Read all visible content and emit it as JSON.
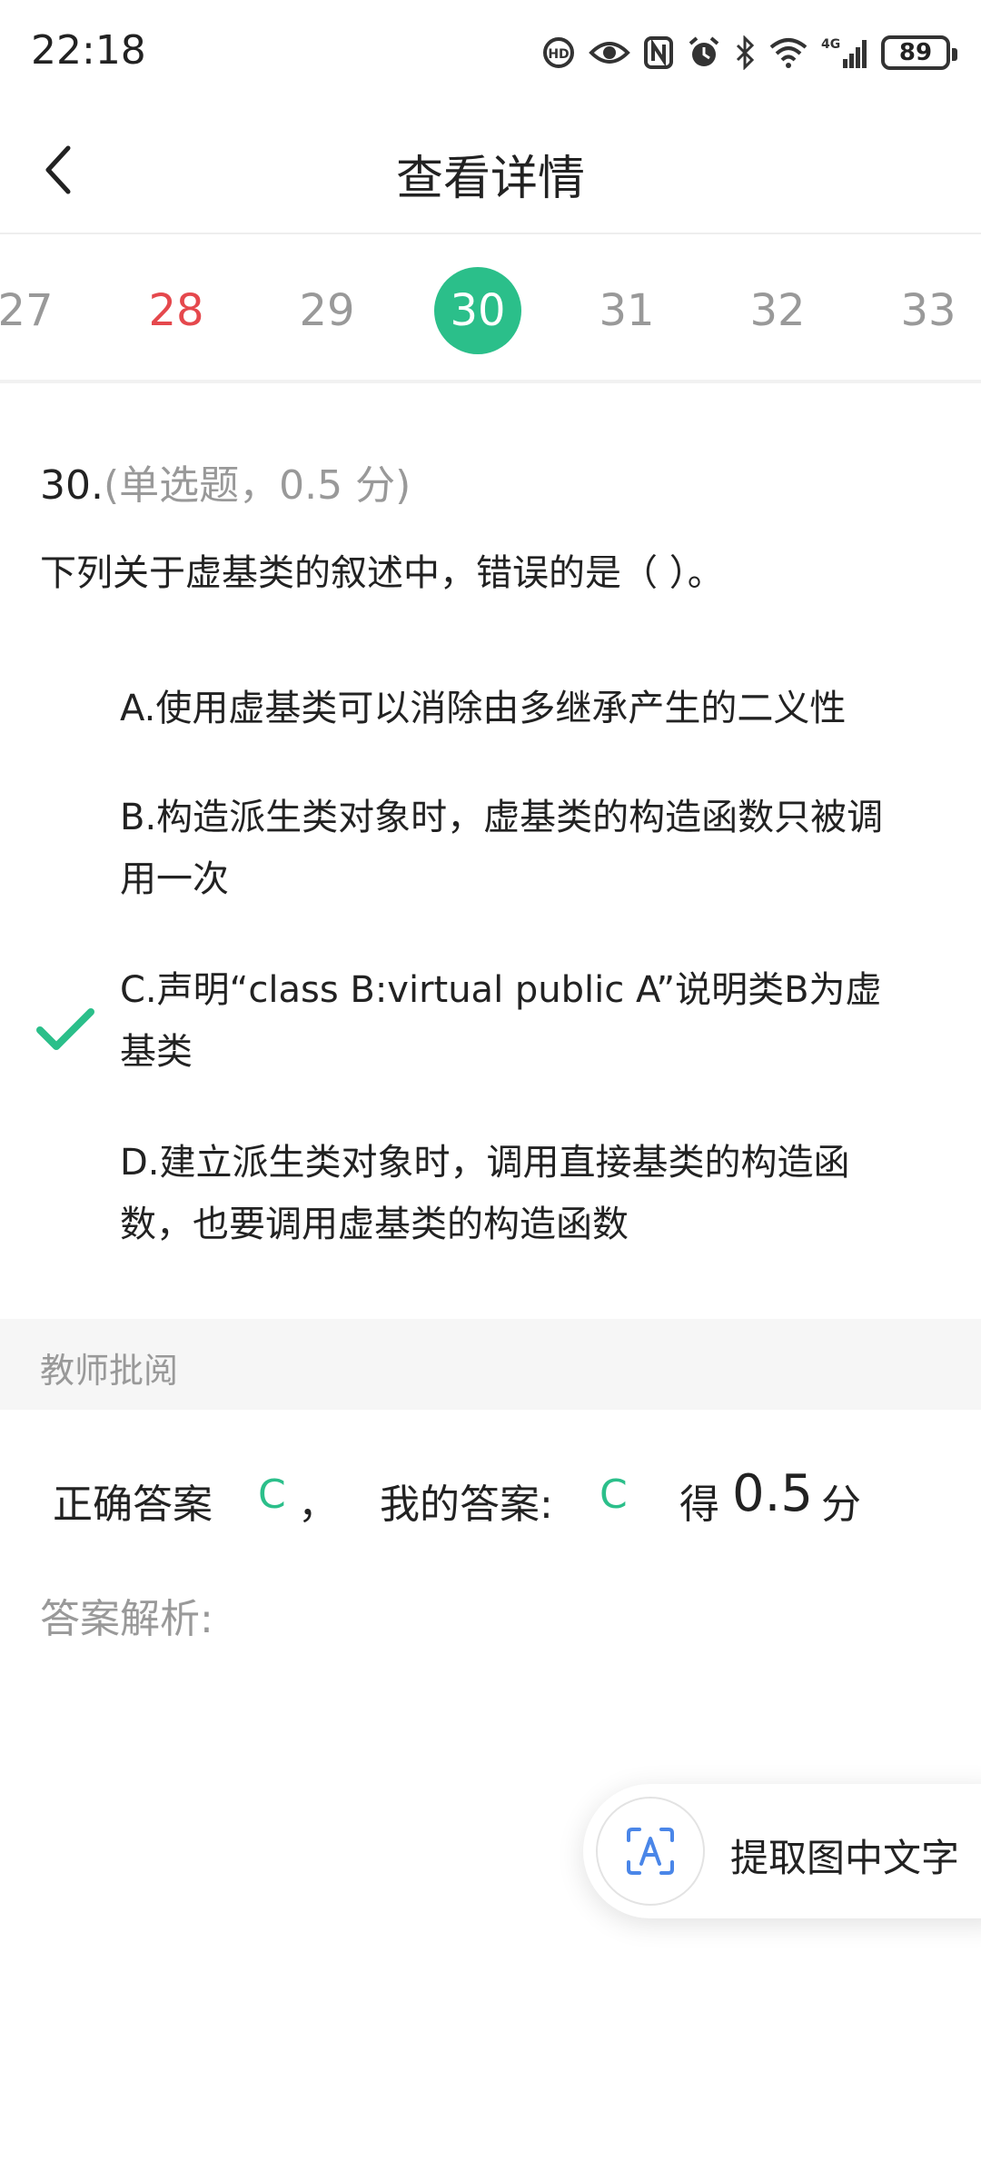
{
  "status_bar": {
    "time": "22:18",
    "battery": "89",
    "icons": [
      "hd-call-icon",
      "eye-icon",
      "nfc-icon",
      "alarm-icon",
      "bluetooth-icon",
      "wifi-icon",
      "4g-signal-icon",
      "battery-icon"
    ]
  },
  "header": {
    "title": "查看详情",
    "back_icon": "chevron-left-icon"
  },
  "number_tabs": [
    "27",
    "28",
    "29",
    "30",
    "31",
    "32",
    "33"
  ],
  "number_tabs_state": {
    "active": "30",
    "highlighted_red": "28",
    "active_color": "#2bbf8a",
    "red_color": "#e5484d"
  },
  "question": {
    "number": "30.",
    "meta": "(单选题，0.5 分)",
    "stem": "下列关于虚基类的叙述中，错误的是（ ）。",
    "options": [
      {
        "text": "A.使用虚基类可以消除由多继承产生的二义性"
      },
      {
        "text_line1": "B.构造派生类对象时，虚基类的构造函数只被调",
        "text_line2": "用一次"
      },
      {
        "text_line1": "C.声明“class B:virtual public A”说明类B为虚",
        "text_line2": "基类",
        "selected": true
      },
      {
        "text_line1": "D.建立派生类对象时，调用直接基类的构造函",
        "text_line2": "数，也要调用虚基类的构造函数"
      }
    ],
    "selected_icon": "checkmark-icon"
  },
  "review": {
    "label": "教师批阅",
    "correct_label": "正确答案",
    "correct_value": "C",
    "comma": "，",
    "my_label": "我的答案:",
    "my_value": "C",
    "score_prefix": "得",
    "score_value": "0.5",
    "score_suffix": "分",
    "analysis_label": "答案解析:"
  },
  "floating_button": {
    "label": "提取图中文字",
    "icon": "text-scan-icon"
  }
}
